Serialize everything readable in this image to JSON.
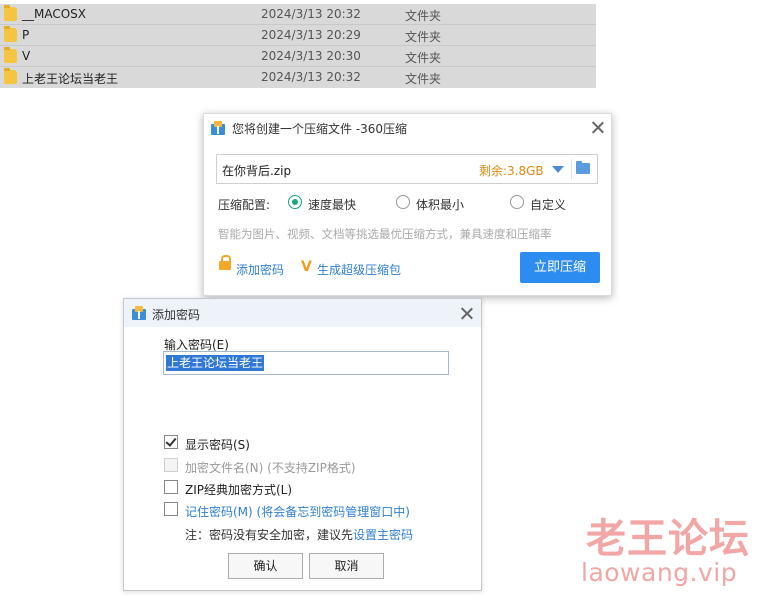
{
  "file_list": [
    {
      "name": "__MACOSX",
      "date": "2024/3/13 20:32",
      "type": "文件夹"
    },
    {
      "name": "P",
      "date": "2024/3/13 20:29",
      "type": "文件夹"
    },
    {
      "name": "V",
      "date": "2024/3/13 20:30",
      "type": "文件夹"
    },
    {
      "name": "上老王论坛当老王",
      "date": "2024/3/13 20:32",
      "type": "文件夹"
    }
  ],
  "zip_dialog": {
    "title": "您将创建一个压缩文件 -360压缩",
    "filename": "在你背后.zip",
    "space_left": "剩余:3.8GB",
    "config_label": "压缩配置:",
    "options": [
      "速度最快",
      "体积最小",
      "自定义"
    ],
    "selected_option": "速度最快",
    "hint": "智能为图片、视频、文档等挑选最优压缩方式，兼具速度和压缩率",
    "add_password": "添加密码",
    "super_zip": "生成超级压缩包",
    "compress_button": "立即压缩"
  },
  "password_dialog": {
    "title": "添加密码",
    "input_label": "输入密码(E)",
    "password_value": "上老王论坛当老王",
    "checkboxes": [
      {
        "label": "显示密码(S)",
        "checked": true,
        "enabled": true
      },
      {
        "label": "加密文件名(N) (不支持ZIP格式)",
        "checked": false,
        "enabled": false
      },
      {
        "label": "ZIP经典加密方式(L)",
        "checked": false,
        "enabled": true
      },
      {
        "label": "记住密码(M) (将会备忘到密码管理窗口中)",
        "checked": false,
        "enabled": true
      }
    ],
    "note": "注：密码没有安全加密，建议先",
    "note_link": "设置主密码",
    "ok_button": "确认",
    "cancel_button": "取消"
  },
  "watermark": {
    "line1": "老王论坛",
    "line2": "laowang.vip"
  }
}
